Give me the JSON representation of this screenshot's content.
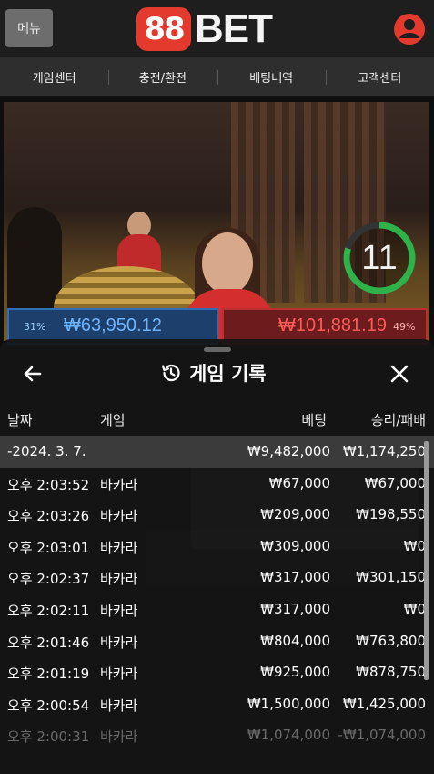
{
  "header": {
    "menu_label": "메뉴",
    "logo_badge": "88",
    "logo_text": "BET"
  },
  "nav": {
    "items": [
      "게임센터",
      "충전/환전",
      "배팅내역",
      "고객센터"
    ]
  },
  "video": {
    "timer": "11",
    "left_amount": "₩63,950.12",
    "left_pct": "31%",
    "right_amount": "₩101,881.19",
    "right_pct": "49%"
  },
  "sheet": {
    "title": "게임 기록",
    "columns": {
      "date": "날짜",
      "game": "게임",
      "bet": "베팅",
      "result": "승리/패배"
    },
    "date_row": {
      "date": "-2024. 3. 7.",
      "bet": "₩9,482,000",
      "result": "₩1,174,250"
    },
    "rows": [
      {
        "time": "오후 2:03:52",
        "game": "바카라",
        "bet": "₩67,000",
        "result": "₩67,000"
      },
      {
        "time": "오후 2:03:26",
        "game": "바카라",
        "bet": "₩209,000",
        "result": "₩198,550"
      },
      {
        "time": "오후 2:03:01",
        "game": "바카라",
        "bet": "₩309,000",
        "result": "₩0"
      },
      {
        "time": "오후 2:02:37",
        "game": "바카라",
        "bet": "₩317,000",
        "result": "₩301,150"
      },
      {
        "time": "오후 2:02:11",
        "game": "바카라",
        "bet": "₩317,000",
        "result": "₩0"
      },
      {
        "time": "오후 2:01:46",
        "game": "바카라",
        "bet": "₩804,000",
        "result": "₩763,800"
      },
      {
        "time": "오후 2:01:19",
        "game": "바카라",
        "bet": "₩925,000",
        "result": "₩878,750"
      },
      {
        "time": "오후 2:00:54",
        "game": "바카라",
        "bet": "₩1,500,000",
        "result": "₩1,425,000"
      },
      {
        "time": "오후 2:00:31",
        "game": "바카라",
        "bet": "₩1,074,000",
        "result": "-₩1,074,000"
      }
    ]
  },
  "colors": {
    "accent_red": "#e43a2d",
    "timer_green": "#2fb24a",
    "player_blue": "#2d6fb8",
    "banker_red": "#b83030"
  }
}
